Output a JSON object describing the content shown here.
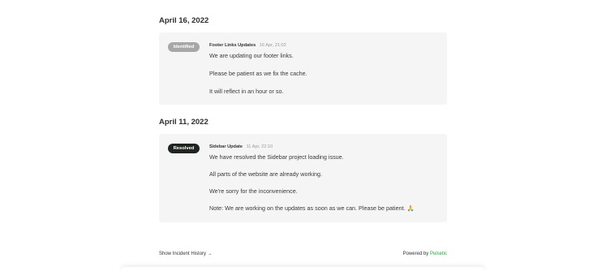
{
  "incidents": [
    {
      "date": "April 16, 2022",
      "status": "Identified",
      "title": "Footer Links Updates",
      "time": "16 Apr, 21:02",
      "messages": [
        "We are updating our footer links.",
        "Please be patient as we fix the cache.",
        "It will reflect in an hour or so."
      ]
    },
    {
      "date": "April 11, 2022",
      "status": "Resolved",
      "title": "Sidebar Update",
      "time": "11 Apr, 22:10",
      "messages": [
        "We have resolved the Sidebar project loading issue.",
        "All parts of the website are already working.",
        "We're sorry for the inconvenience.",
        "Note: We are working on the updates as soon as we can. Please be patient. 🙏"
      ]
    }
  ],
  "footer": {
    "history_link": "Show Incident History →",
    "powered_by": "Powered by",
    "brand": "Pulsetic"
  },
  "colors": {
    "card_background": "#f5f5f5",
    "identified_badge": "#a7a7a7",
    "resolved_badge": "#1f2420",
    "brand_green": "#2ea043"
  }
}
